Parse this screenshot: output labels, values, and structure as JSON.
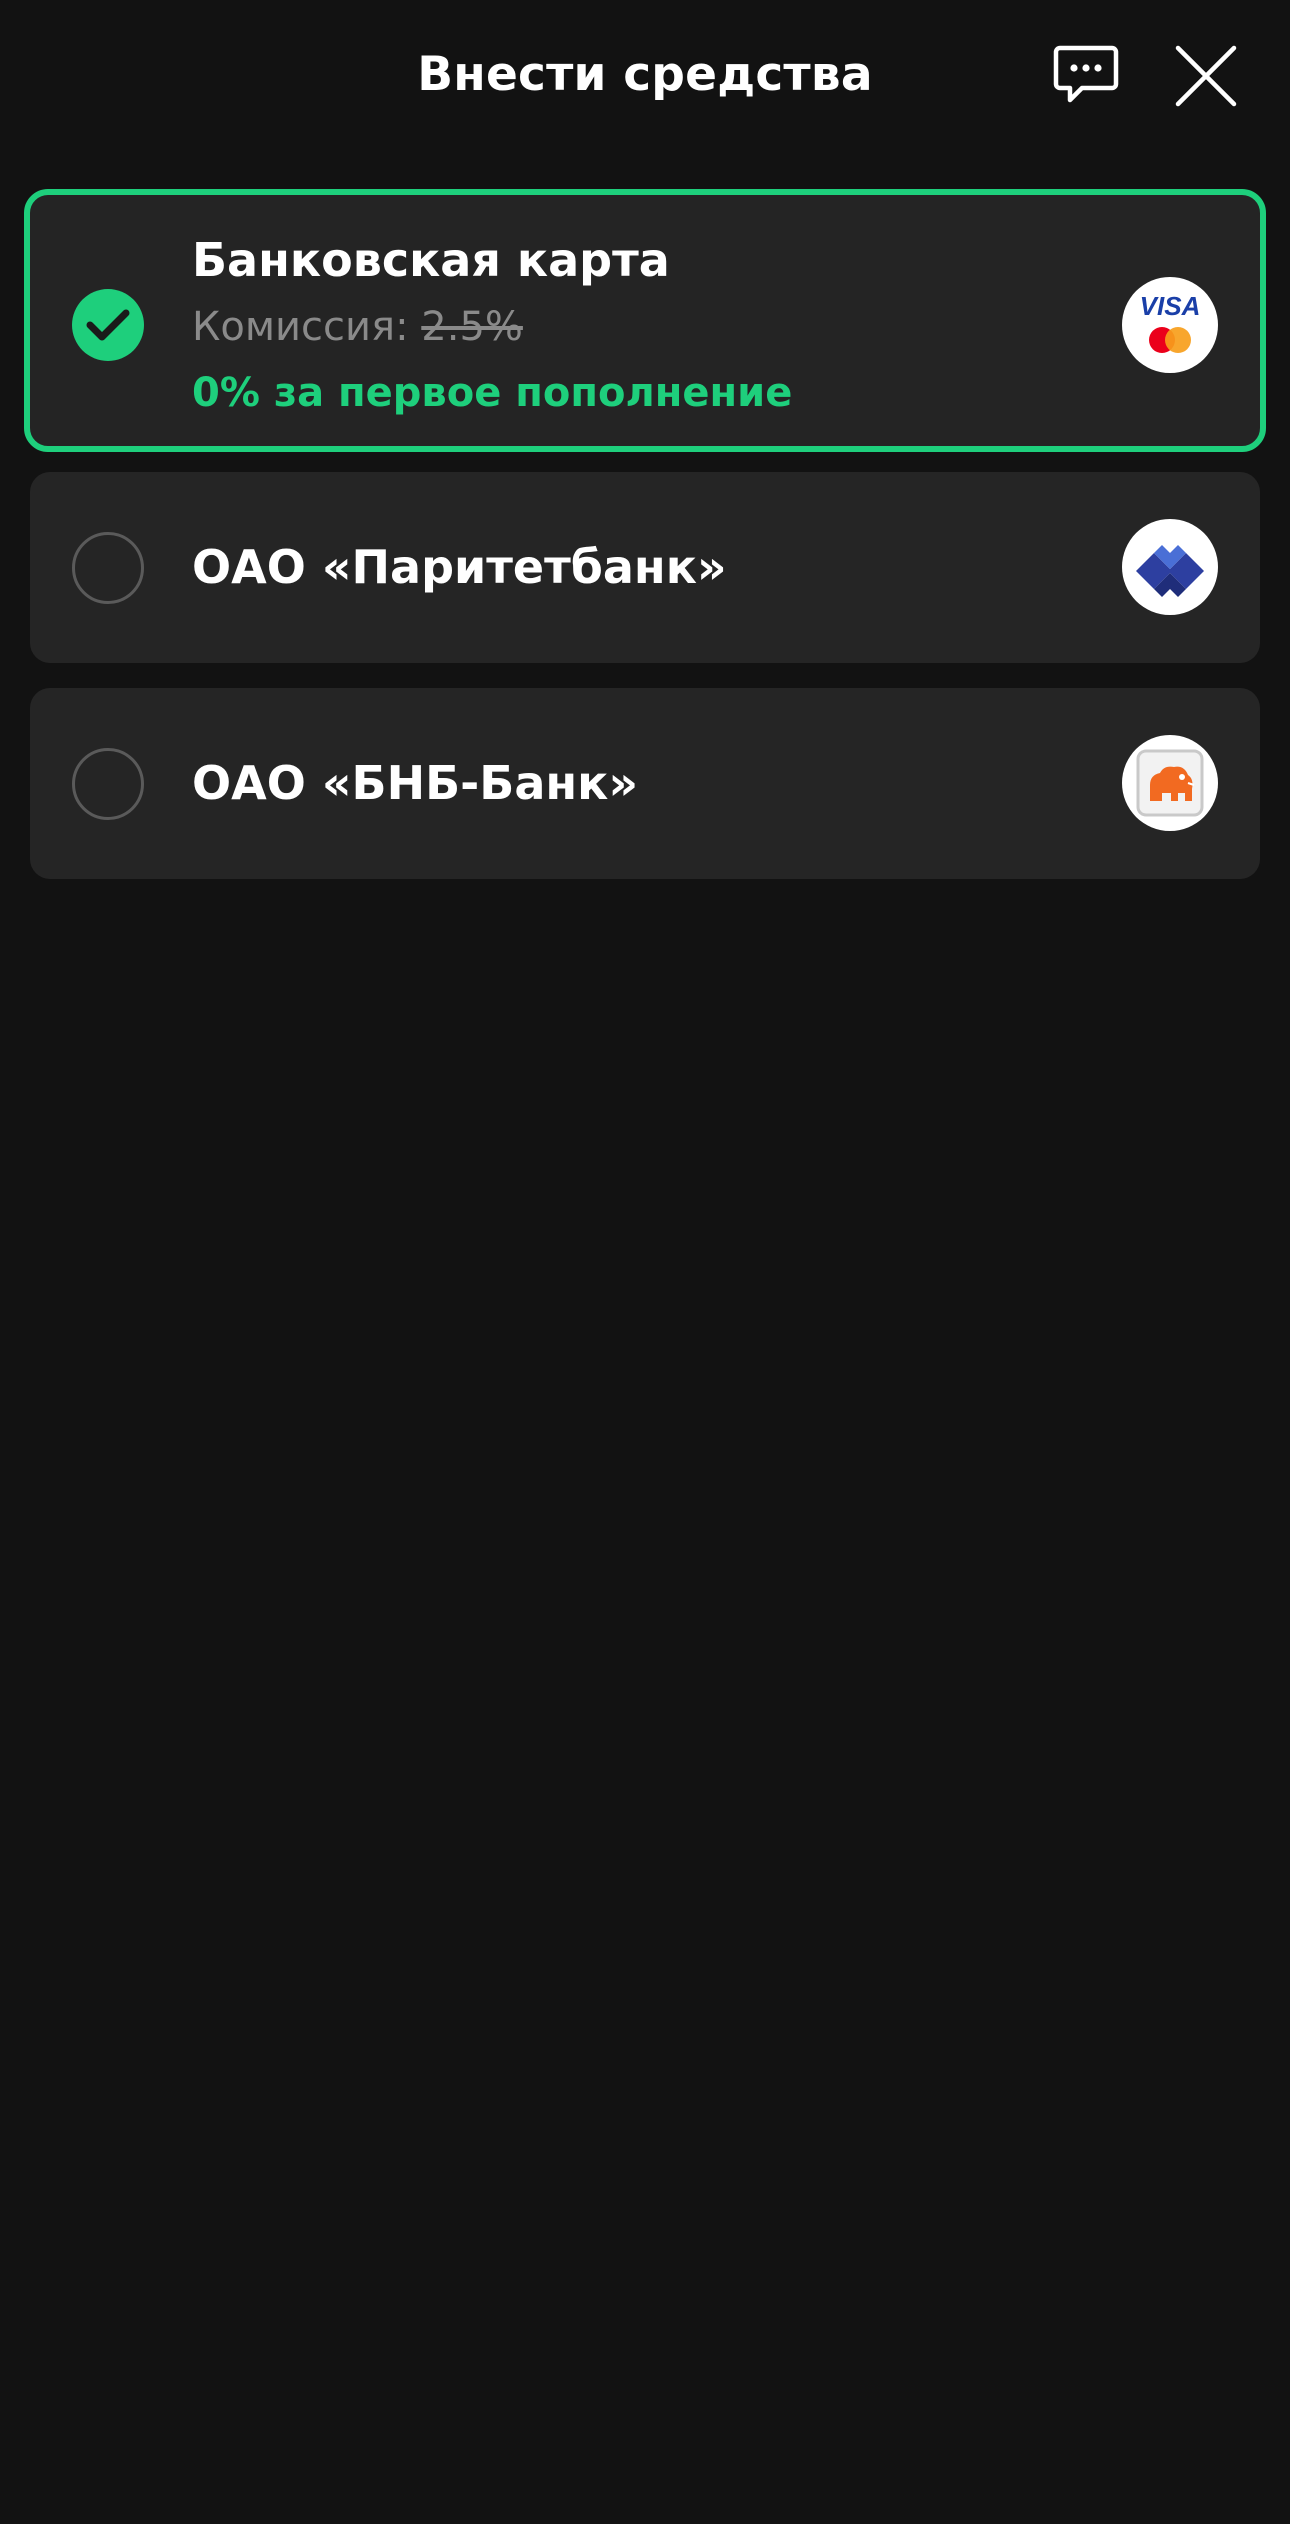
{
  "header": {
    "title": "Внести средства",
    "chat_icon": "chat-bubble-icon",
    "close_icon": "close-icon"
  },
  "options": [
    {
      "title": "Банковская карта",
      "commission_label": "Комиссия:",
      "commission_old": "2.5%",
      "promo": "0% за первое пополнение",
      "selected": true,
      "logo": "visa-mastercard-logo"
    },
    {
      "title": "ОАО «Паритетбанк»",
      "selected": false,
      "logo": "paritetbank-logo"
    },
    {
      "title": "ОАО «БНБ-Банк»",
      "selected": false,
      "logo": "bnb-bank-lion-logo"
    }
  ],
  "logo_texts": {
    "visa": "VISA"
  },
  "colors": {
    "background": "#121212",
    "card": "#252525",
    "accent": "#1ecf7c",
    "muted_text": "#8a8a8a"
  }
}
